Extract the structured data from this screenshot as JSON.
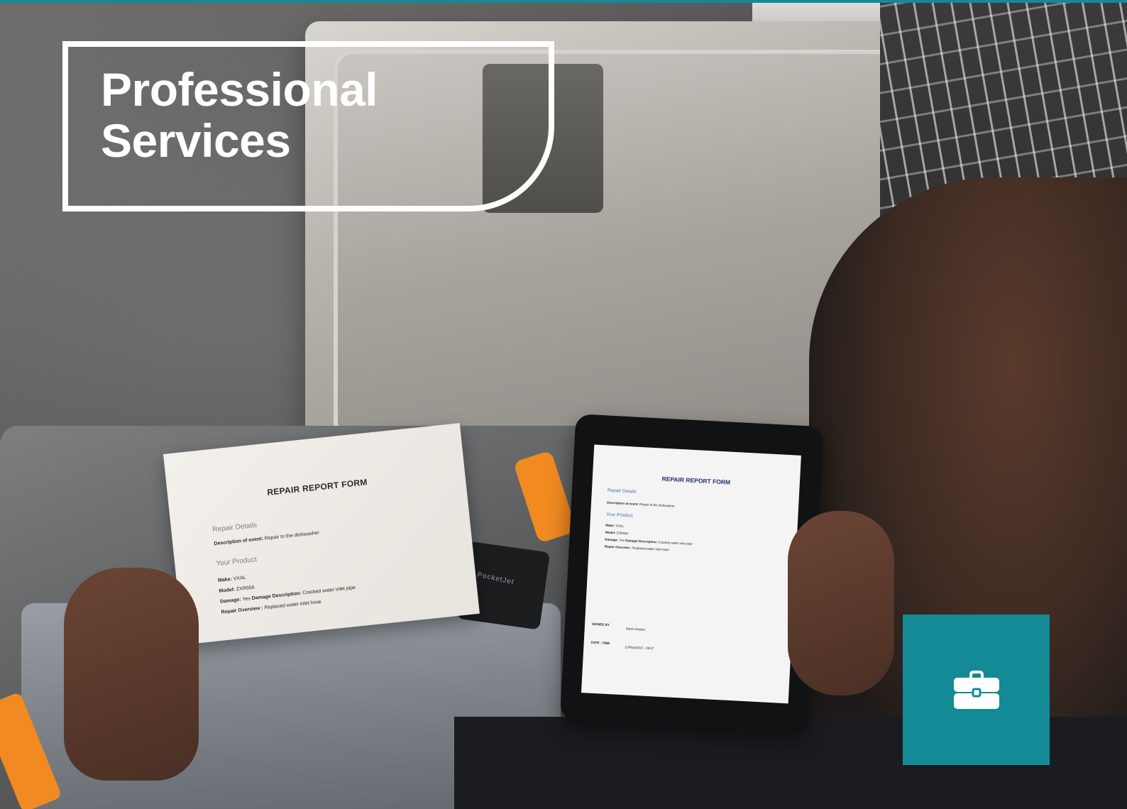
{
  "header": {
    "title_line1": "Professional",
    "title_line2": "Services"
  },
  "photo": {
    "paper_form": {
      "title": "REPAIR REPORT FORM",
      "section_repair": "Repair Details",
      "description_label": "Description of event:",
      "description_value": "Repair to the dishwasher",
      "section_product": "Your Product",
      "make_label": "Make:",
      "make_value": "VXAL",
      "model_label": "Model:",
      "model_value": "ZXR656",
      "damage_label": "Damage:",
      "damage_value": "Yes",
      "damage_desc_label": "Damage Description:",
      "damage_desc_value": "Cracked water inlet pipe",
      "overview_label": "Repair Overview :",
      "overview_value": "Replaced water inlet hose"
    },
    "tablet_form": {
      "title": "REPAIR REPORT FORM",
      "section_repair": "Repair Details",
      "description_label": "Description of event:",
      "description_value": "Repair to the dishwasher",
      "section_product": "Your Product",
      "make_label": "Make:",
      "make_value": "VXAL",
      "model_label": "Model:",
      "model_value": "ZXR656",
      "damage_label": "Damage:",
      "damage_value": "Yes",
      "damage_desc_label": "Damage Description:",
      "damage_desc_value": "Cracked water inlet pipe",
      "overview_label": "Repair Overview :",
      "overview_value": "Replaced water inlet hose",
      "signed_label": "SIGNED BY",
      "signed_value": "Aaron Davies",
      "date_label": "DATE - TIME",
      "date_value": "11/May/2022 - 09:57"
    },
    "printer_brand": "PocketJet"
  },
  "icon_tile": {
    "icon": "briefcase-icon",
    "color": "#138a96"
  },
  "colors": {
    "accent": "#138a96",
    "title_text": "#ffffff"
  }
}
